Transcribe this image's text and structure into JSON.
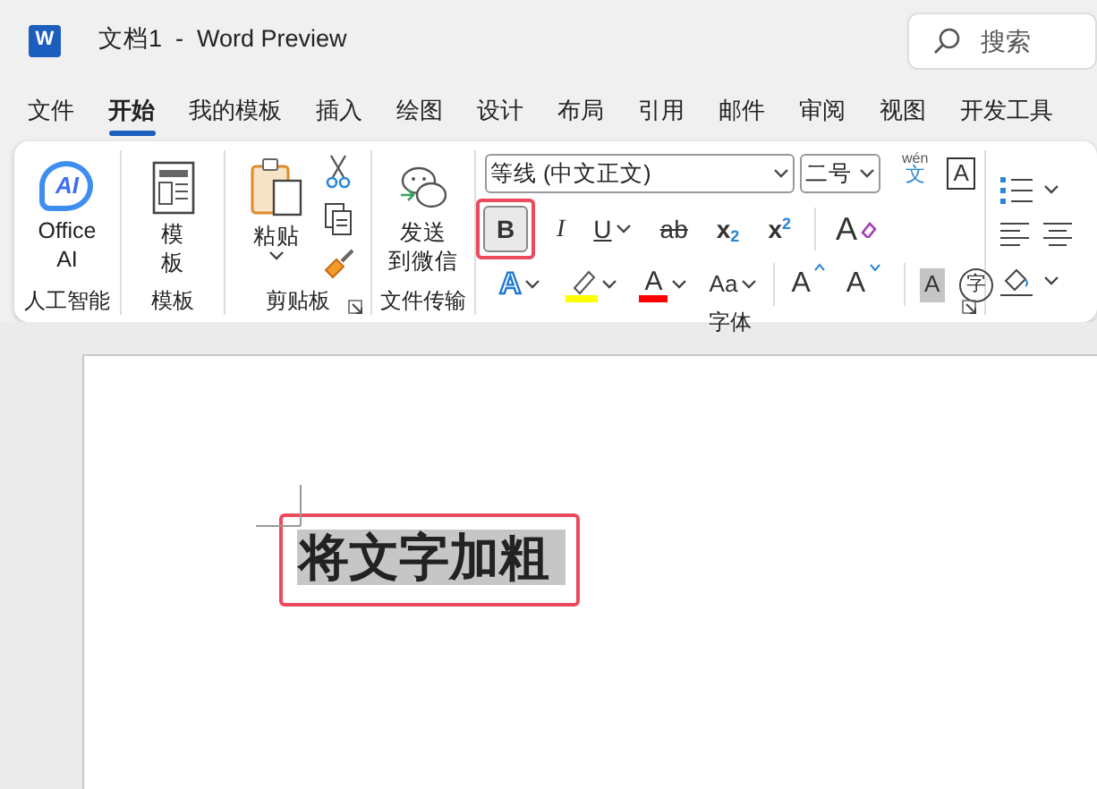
{
  "window": {
    "logo_letter": "W",
    "doc_name": "文档1",
    "separator": "-",
    "app_name": "Word Preview"
  },
  "search": {
    "placeholder": "搜索"
  },
  "tabs": [
    {
      "label": "文件",
      "selected": false
    },
    {
      "label": "开始",
      "selected": true
    },
    {
      "label": "我的模板",
      "selected": false
    },
    {
      "label": "插入",
      "selected": false
    },
    {
      "label": "绘图",
      "selected": false
    },
    {
      "label": "设计",
      "selected": false
    },
    {
      "label": "布局",
      "selected": false
    },
    {
      "label": "引用",
      "selected": false
    },
    {
      "label": "邮件",
      "selected": false
    },
    {
      "label": "审阅",
      "selected": false
    },
    {
      "label": "视图",
      "selected": false
    },
    {
      "label": "开发工具",
      "selected": false
    }
  ],
  "ribbon": {
    "groups": [
      {
        "kind": "ai",
        "label": "人工智能",
        "logo": "AI",
        "lines": [
          "Office",
          "AI"
        ]
      },
      {
        "kind": "template",
        "label": "模板",
        "lines": [
          "模",
          "板"
        ]
      },
      {
        "kind": "clipboard",
        "label": "剪贴板",
        "paste_label": "粘贴",
        "dialog_launcher": true
      },
      {
        "kind": "transfer",
        "label": "文件传输",
        "lines": [
          "发送",
          "到微信"
        ]
      },
      {
        "kind": "font",
        "label": "字体",
        "font_name": "等线 (中文正文)",
        "font_size": "二号",
        "dialog_launcher": true,
        "toolbars": [
          {
            "controls": [
              {
                "kind": "phonetic",
                "glyph": "文",
                "top": "wén"
              },
              {
                "kind": "border",
                "glyph": "A"
              }
            ]
          },
          {
            "controls": [
              {
                "kind": "bold",
                "glyph": "B",
                "on": true,
                "annotated": true,
                "dropdown": false
              },
              {
                "kind": "italic",
                "glyph": "I",
                "on": false,
                "annotated": false,
                "dropdown": false
              },
              {
                "kind": "underline",
                "glyph": "U",
                "on": false,
                "annotated": false,
                "dropdown": true
              },
              {
                "kind": "strike",
                "glyph": "ab",
                "on": false,
                "annotated": false,
                "dropdown": false
              },
              {
                "kind": "sub",
                "glyph": "x",
                "index": "2",
                "on": false,
                "annotated": false,
                "dropdown": false
              },
              {
                "kind": "sup",
                "glyph": "x",
                "index": "2",
                "on": false,
                "annotated": false,
                "dropdown": false
              },
              {
                "kind": "divider"
              },
              {
                "kind": "clear",
                "glyph": "A"
              }
            ]
          },
          {
            "controls": [
              {
                "kind": "effects",
                "glyph": "A",
                "dropdown": true
              },
              {
                "kind": "highlight",
                "color": "#ffff00",
                "dropdown": true
              },
              {
                "kind": "color",
                "glyph": "A",
                "color": "#ff0000",
                "dropdown": true
              },
              {
                "kind": "case",
                "glyph": "Aa",
                "dropdown": true
              },
              {
                "kind": "divider"
              },
              {
                "kind": "grow",
                "glyph": "A"
              },
              {
                "kind": "shrink",
                "glyph": "A"
              },
              {
                "kind": "divider"
              },
              {
                "kind": "shade",
                "glyph": "A"
              },
              {
                "kind": "enclose",
                "glyph": "字"
              }
            ]
          }
        ]
      },
      {
        "kind": "paragraph"
      }
    ]
  },
  "document": {
    "text": "将文字加粗",
    "selected": true,
    "bold": true,
    "annotated": true
  }
}
